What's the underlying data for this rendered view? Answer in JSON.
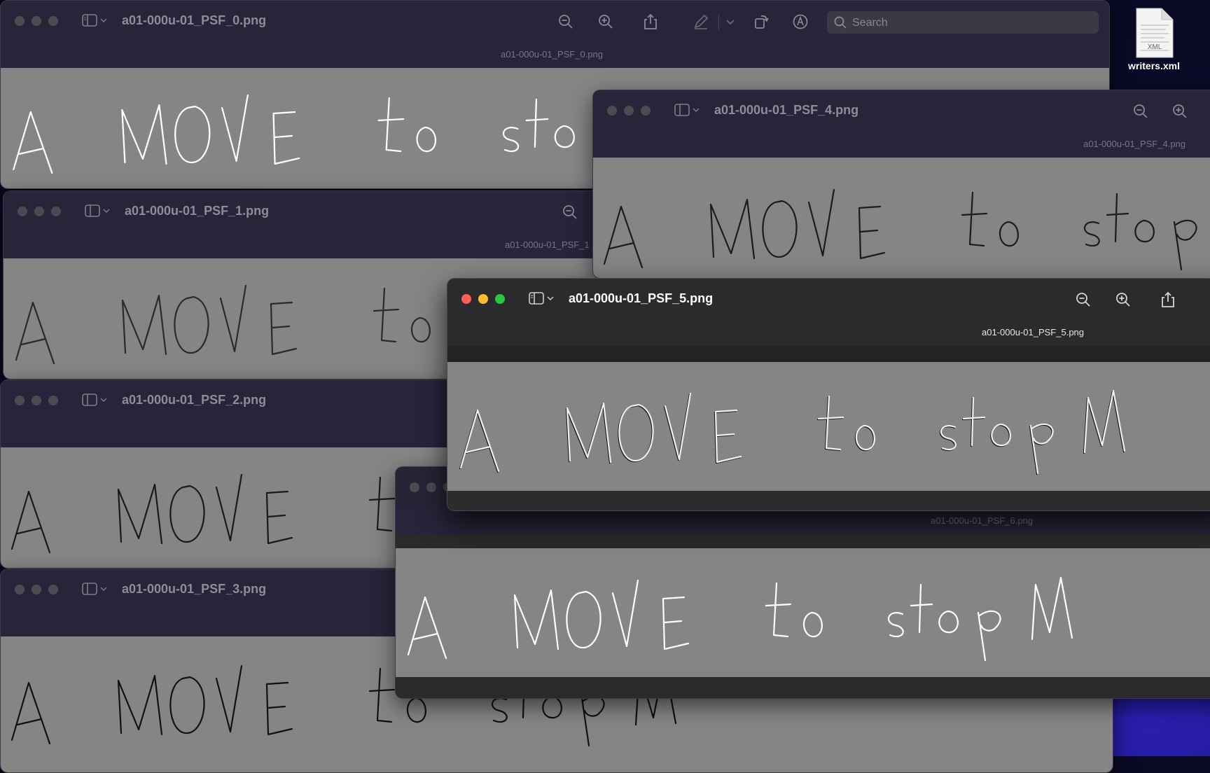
{
  "desktop": {
    "file_label": "writers.xml",
    "file_badge": "XML"
  },
  "handwriting": {
    "line": "A MOVE to stop M",
    "ink_dark": "#111111",
    "ink_light": "#ffffff"
  },
  "search": {
    "placeholder": "Search"
  },
  "windows": [
    {
      "title": "a01-000u-01_PSF_0.png",
      "subtitle": "a01-000u-01_PSF_0.png",
      "ink": "light"
    },
    {
      "title": "a01-000u-01_PSF_1.png",
      "subtitle": "a01-000u-01_PSF_1",
      "ink": "dark"
    },
    {
      "title": "a01-000u-01_PSF_2.png",
      "subtitle": "",
      "ink": "dark"
    },
    {
      "title": "a01-000u-01_PSF_3.png",
      "subtitle": "",
      "ink": "dark"
    },
    {
      "title": "a01-000u-01_PSF_4.png",
      "subtitle": "a01-000u-01_PSF_4.png",
      "ink": "dark"
    },
    {
      "title": "",
      "subtitle": "a01-000u-01_PSF_6.png",
      "ink": "light"
    },
    {
      "title": "a01-000u-01_PSF_5.png",
      "subtitle": "a01-000u-01_PSF_5.png",
      "ink": "mixed"
    }
  ],
  "icons": {
    "zoom_out": "zoom-out-icon",
    "zoom_in": "zoom-in-icon",
    "share": "share-icon",
    "markup": "markup-pen-icon",
    "rotate": "rotate-icon",
    "annotate": "annotate-icon",
    "sidebar": "sidebar-toggle-icon",
    "xml_file": "xml-file-icon"
  },
  "colors": {
    "image_background": "#858585",
    "titlebar_inactive": "#27253a",
    "titlebar_active": "#2b2b2d",
    "close": "#ff5f57",
    "minimize": "#febc2e",
    "zoom": "#28c840"
  }
}
